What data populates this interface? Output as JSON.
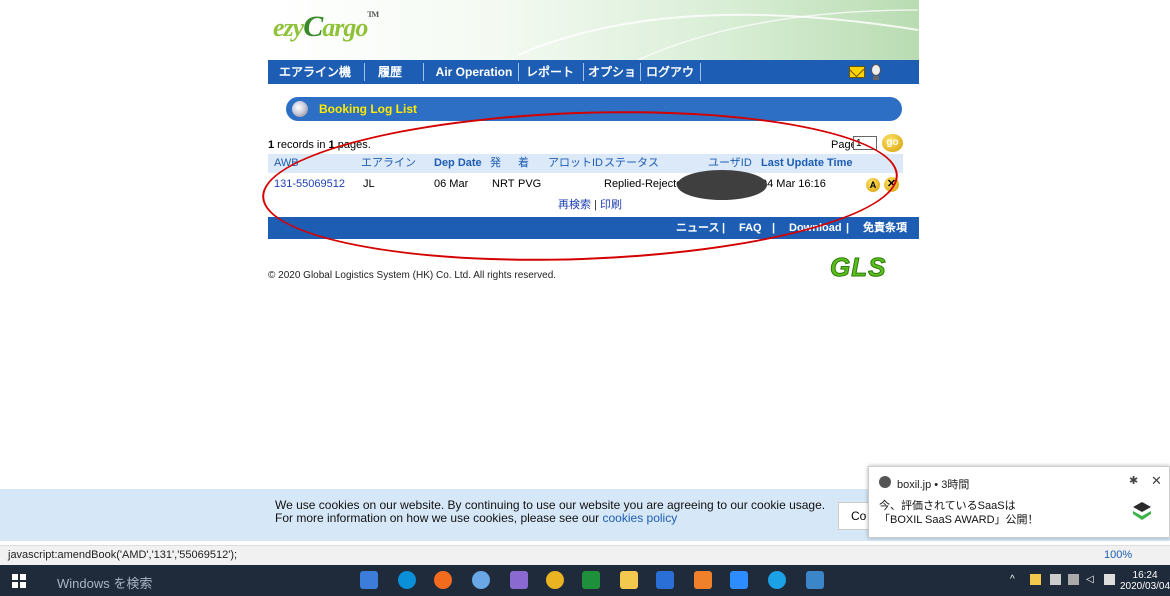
{
  "app": {
    "logo_text_prefix": "ezy",
    "logo_text_c": "C",
    "logo_text_suffix": "argo",
    "logo_tm": "TM"
  },
  "nav": {
    "items": [
      "エアライン機能",
      "履歴",
      "Air Operation",
      "レポート",
      "オプション",
      "ログアウト"
    ]
  },
  "section": {
    "title": "Booking Log List"
  },
  "records": {
    "count": "1",
    "mid": " records in ",
    "pages": "1",
    "suffix": " pages."
  },
  "pager": {
    "label": "Page",
    "value": "1",
    "go": "go"
  },
  "table": {
    "headers": [
      "AWB",
      "エアライン",
      "Dep Date",
      "発",
      "着",
      "アロットID",
      "ステータス",
      "ユーザID",
      "Last Update Time"
    ],
    "row": {
      "awb": "131-55069512",
      "airline": "JL",
      "dep_date": "06 Mar",
      "origin": "NRT",
      "dest": "PVG",
      "allot_id": "",
      "status": "Replied-Rejected",
      "user_id": "",
      "last_update": "04 Mar 16:16"
    }
  },
  "actions": {
    "research": "再検索",
    "separator": " | ",
    "print": "印刷"
  },
  "footer_links": [
    "ニュース",
    "FAQ",
    "Download",
    "免責条項"
  ],
  "gls_logo": "GLS",
  "copyright": "© 2020 Global Logistics System (HK) Co. Ltd. All rights reserved.",
  "cookie": {
    "line1": "We use cookies on our website. By continuing to use our website you are agreeing to our cookie usage.",
    "line2_prefix": "For more information on how we use cookies, please see our ",
    "link": "cookies policy",
    "button": "Co"
  },
  "notification": {
    "source": "boxil.jp • 3時間",
    "line1": "今、評価されているSaaSは",
    "line2": "「BOXIL SaaS AWARD」公開！"
  },
  "statusbar": {
    "text": "javascript:amendBook('AMD','131','55069512');",
    "zoom": "100%"
  },
  "taskbar": {
    "search": "Windows を検索",
    "time": "16:24",
    "date": "2020/03/04"
  },
  "colors": {
    "nav_blue": "#1d5db3",
    "section_yellow": "#ffea00",
    "annotation_red": "#d40000"
  }
}
